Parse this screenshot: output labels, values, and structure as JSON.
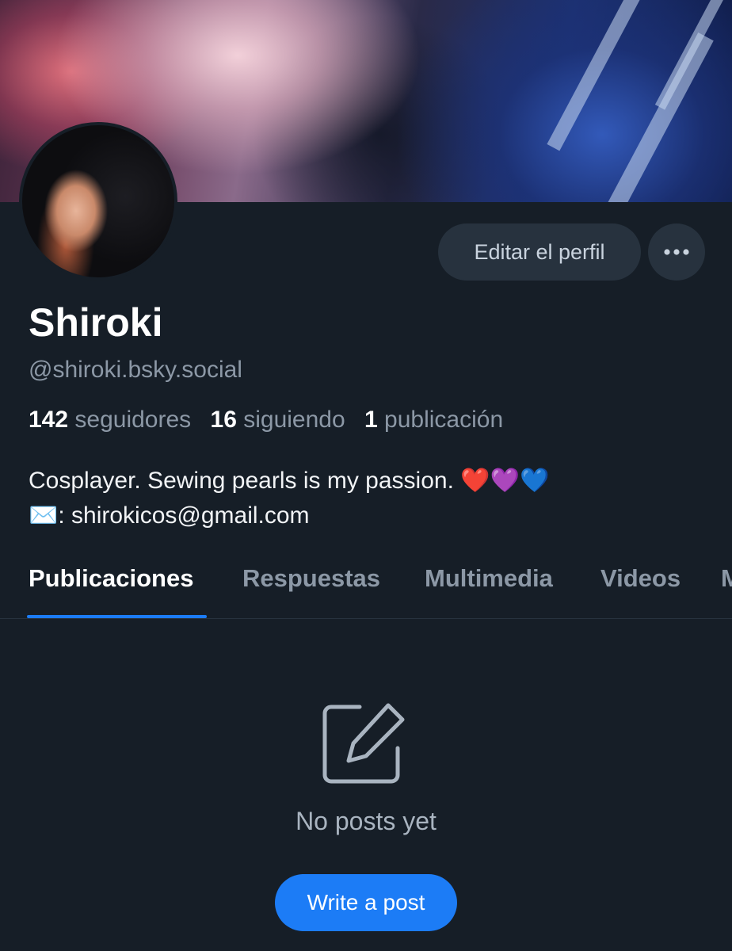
{
  "profile": {
    "display_name": "Shiroki",
    "handle": "@shiroki.bsky.social",
    "stats": {
      "followers_count": "142",
      "followers_label": "seguidores",
      "following_count": "16",
      "following_label": "siguiendo",
      "posts_count": "1",
      "posts_label": "publicación"
    },
    "bio_line1": "Cosplayer. Sewing pearls is my passion.  ❤️💜💙",
    "bio_line2": "✉️: shirokicos@gmail.com"
  },
  "actions": {
    "edit_profile_label": "Editar el perfil",
    "more_icon": "ellipsis-icon"
  },
  "tabs": [
    {
      "label": "Publicaciones",
      "active": true
    },
    {
      "label": "Respuestas",
      "active": false
    },
    {
      "label": "Multimedia",
      "active": false
    },
    {
      "label": "Videos",
      "active": false
    },
    {
      "label": "M",
      "active": false
    }
  ],
  "empty_state": {
    "icon": "edit-icon",
    "message": "No posts yet",
    "button_label": "Write a post"
  },
  "colors": {
    "background": "#161e27",
    "accent": "#1c7cf6",
    "button_bg": "#27323e",
    "muted_text": "#8c98a6"
  }
}
